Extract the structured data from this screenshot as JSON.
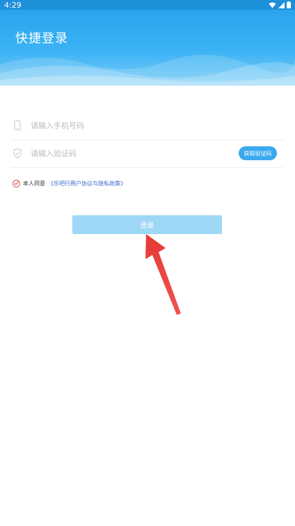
{
  "status_bar": {
    "time": "4:29"
  },
  "header": {
    "title": "快捷登录"
  },
  "form": {
    "phone_placeholder": "请输入手机号码",
    "code_placeholder": "请输入验证码",
    "get_code_label": "获取验证码",
    "agree_prefix": "本人同意",
    "agree_link": "《乐吧行用户协议与隐私政策》",
    "login_label": "登录"
  },
  "colors": {
    "header_top": "#2aa3ee",
    "button_disabled": "#9fd7f7",
    "accent": "#3aa9ee",
    "check": "#d9534f",
    "link": "#3a69c9",
    "annotation_arrow": "#e53935"
  }
}
